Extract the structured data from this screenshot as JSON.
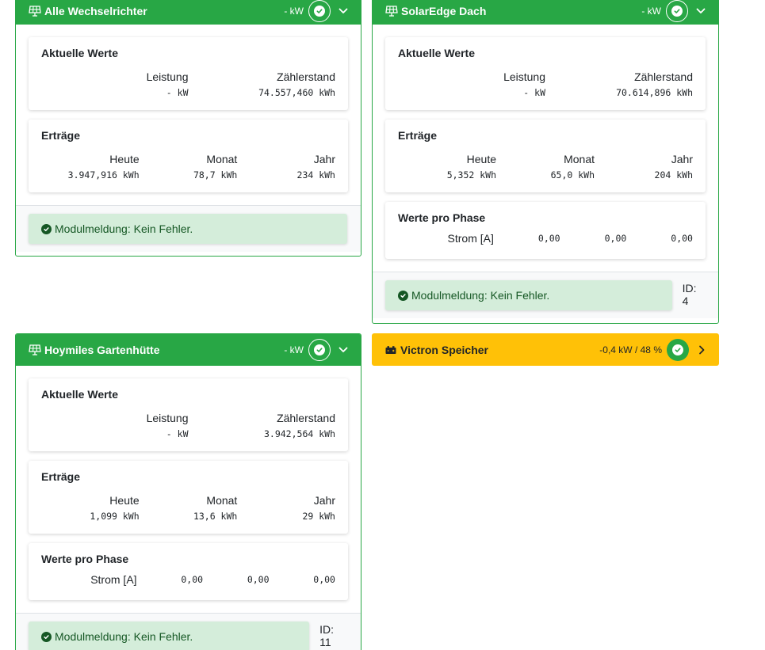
{
  "colors": {
    "success": "#28a745",
    "warning": "#ffc107",
    "alert_bg": "#d4edda",
    "alert_text": "#155724"
  },
  "cards": [
    {
      "title": "Alle Wechselrichter",
      "icon": "solar-panel-icon",
      "power": "- kW",
      "aktuelle": {
        "title": "Aktuelle Werte",
        "leistung_label": "Leistung",
        "leistung": "- kW",
        "zaehler_label": "Zählerstand",
        "zaehler": "74.557,460 kWh"
      },
      "ertraege": {
        "title": "Erträge",
        "heute_label": "Heute",
        "heute": "3.947,916 kWh",
        "monat_label": "Monat",
        "monat": "78,7 kWh",
        "jahr_label": "Jahr",
        "jahr": "234 kWh"
      },
      "message": "Modulmeldung: Kein Fehler."
    },
    {
      "title": "SolarEdge Dach",
      "icon": "solar-panel-icon",
      "power": "- kW",
      "aktuelle": {
        "title": "Aktuelle Werte",
        "leistung_label": "Leistung",
        "leistung": "- kW",
        "zaehler_label": "Zählerstand",
        "zaehler": "70.614,896 kWh"
      },
      "ertraege": {
        "title": "Erträge",
        "heute_label": "Heute",
        "heute": "5,352 kWh",
        "monat_label": "Monat",
        "monat": "65,0 kWh",
        "jahr_label": "Jahr",
        "jahr": "204 kWh"
      },
      "phase": {
        "title": "Werte pro Phase",
        "label": "Strom [A]",
        "values": [
          "0,00",
          "0,00",
          "0,00"
        ]
      },
      "message": "Modulmeldung: Kein Fehler.",
      "id": "ID: 4"
    },
    {
      "title": "Hoymiles Gartenhütte",
      "icon": "solar-panel-icon",
      "power": "- kW",
      "aktuelle": {
        "title": "Aktuelle Werte",
        "leistung_label": "Leistung",
        "leistung": "- kW",
        "zaehler_label": "Zählerstand",
        "zaehler": "3.942,564 kWh"
      },
      "ertraege": {
        "title": "Erträge",
        "heute_label": "Heute",
        "heute": "1,099 kWh",
        "monat_label": "Monat",
        "monat": "13,6 kWh",
        "jahr_label": "Jahr",
        "jahr": "29 kWh"
      },
      "phase": {
        "title": "Werte pro Phase",
        "label": "Strom [A]",
        "values": [
          "0,00",
          "0,00",
          "0,00"
        ]
      },
      "message": "Modulmeldung: Kein Fehler.",
      "id": "ID: 11"
    }
  ],
  "victron": {
    "title": "Victron Speicher",
    "icon": "battery-icon",
    "status": "-0,4 kW / 48 %"
  }
}
